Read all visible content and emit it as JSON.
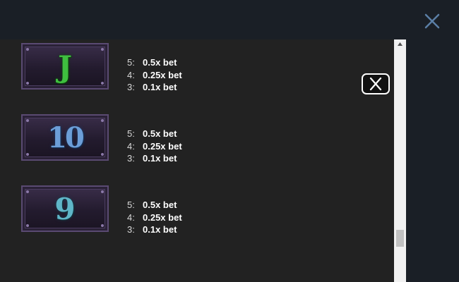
{
  "window": {
    "close_icon": "close-icon",
    "close_color": "#5b7fa6"
  },
  "paytable": {
    "rows": [
      {
        "symbol": "J",
        "symbol_color": "#3fbf3f",
        "payouts": [
          {
            "count": "5:",
            "value": "0.5x bet"
          },
          {
            "count": "4:",
            "value": "0.25x bet"
          },
          {
            "count": "3:",
            "value": "0.1x bet"
          }
        ]
      },
      {
        "symbol": "10",
        "symbol_color": "#6c9ed8",
        "payouts": [
          {
            "count": "5:",
            "value": "0.5x bet"
          },
          {
            "count": "4:",
            "value": "0.25x bet"
          },
          {
            "count": "3:",
            "value": "0.1x bet"
          }
        ]
      },
      {
        "symbol": "9",
        "symbol_color": "#5fb6c8",
        "payouts": [
          {
            "count": "5:",
            "value": "0.5x bet"
          },
          {
            "count": "4:",
            "value": "0.25x bet"
          },
          {
            "count": "3:",
            "value": "0.1x bet"
          }
        ]
      }
    ],
    "close_button_icon": "close-icon"
  },
  "scrollbar": {
    "position_fraction": 0.95
  }
}
